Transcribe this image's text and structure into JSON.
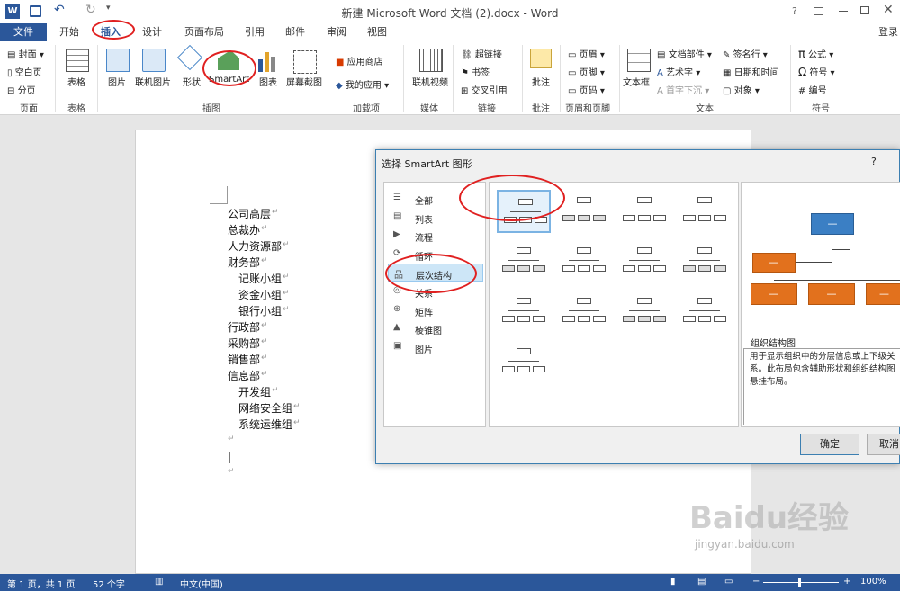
{
  "window": {
    "title": "新建 Microsoft Word 文档 (2).docx - Word",
    "help": "?",
    "login": "登录"
  },
  "tabs": [
    "文件",
    "开始",
    "插入",
    "设计",
    "页面布局",
    "引用",
    "邮件",
    "审阅",
    "视图"
  ],
  "ribbon": {
    "pages": {
      "cover": "封面",
      "blank": "空白页",
      "break": "分页",
      "group": "页面"
    },
    "table": {
      "label": "表格",
      "group": "表格"
    },
    "illustrations": {
      "picture": "图片",
      "online_picture": "联机图片",
      "shapes": "形状",
      "smartart": "SmartArt",
      "chart": "图表",
      "screenshot": "屏幕截图",
      "group": "插图"
    },
    "addins": {
      "store": "应用商店",
      "myapps": "我的应用",
      "group": "加载项"
    },
    "media": {
      "video": "联机视频",
      "group": "媒体"
    },
    "links": {
      "hyperlink": "超链接",
      "bookmark": "书签",
      "crossref": "交叉引用",
      "group": "链接"
    },
    "comments": {
      "comment": "批注",
      "group": "批注"
    },
    "headerfooter": {
      "header": "页眉",
      "footer": "页脚",
      "pagenum": "页码",
      "group": "页眉和页脚"
    },
    "text": {
      "textbox": "文本框",
      "quickparts": "文档部件",
      "wordart": "艺术字",
      "dropcap": "首字下沉",
      "signature": "签名行",
      "datetime": "日期和时间",
      "object": "对象",
      "group": "文本"
    },
    "symbols": {
      "equation": "公式",
      "symbol": "符号",
      "number": "编号",
      "group": "符号"
    }
  },
  "document": {
    "lines": [
      {
        "text": "公司高层",
        "indent": 0
      },
      {
        "text": "总裁办",
        "indent": 0
      },
      {
        "text": "人力资源部",
        "indent": 0
      },
      {
        "text": "财务部",
        "indent": 0
      },
      {
        "text": "记账小组",
        "indent": 1
      },
      {
        "text": "资金小组",
        "indent": 1
      },
      {
        "text": "银行小组",
        "indent": 1
      },
      {
        "text": "行政部",
        "indent": 0
      },
      {
        "text": "采购部",
        "indent": 0
      },
      {
        "text": "销售部",
        "indent": 0
      },
      {
        "text": "信息部",
        "indent": 0
      },
      {
        "text": "开发组",
        "indent": 1
      },
      {
        "text": "网络安全组",
        "indent": 1
      },
      {
        "text": "系统运维组",
        "indent": 1
      }
    ]
  },
  "dialog": {
    "title": "选择 SmartArt 图形",
    "help": "?",
    "categories": [
      "全部",
      "列表",
      "流程",
      "循环",
      "层次结构",
      "关系",
      "矩阵",
      "棱锥图",
      "图片"
    ],
    "selected_category": "层次结构",
    "preview_box": "—",
    "preview_title": "组织结构图",
    "preview_desc": [
      "用于显示组织中的分层信息或上下级关",
      "系。此布局包含辅助形状和组织结构图",
      "悬挂布局。"
    ],
    "ok": "确定",
    "cancel": "取消"
  },
  "statusbar": {
    "page": "第 1 页，共 1 页",
    "words": "52 个字",
    "lang": "中文(中国)",
    "zoom": "100%"
  },
  "watermark": {
    "logo": "Baidu经验",
    "url": "jingyan.baidu.com"
  },
  "colors": {
    "accent": "#2b579a",
    "smartart_blue": "#3b7fc4",
    "smartart_orange": "#e2711d",
    "annotation": "#e02020"
  }
}
